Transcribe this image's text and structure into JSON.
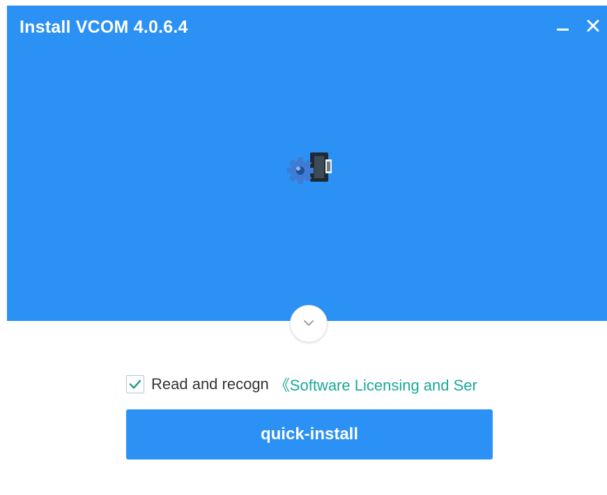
{
  "window": {
    "title": "Install VCOM 4.0.6.4"
  },
  "icons": {
    "minimize": "minimize-icon",
    "close": "close-icon",
    "app": "installer-gear-icon",
    "expand": "chevron-down-icon",
    "check": "checkmark-icon"
  },
  "agreement": {
    "checked": true,
    "text": "Read and recogn",
    "link_text": "《Software Licensing and Ser"
  },
  "install_button": {
    "label": "quick-install"
  },
  "colors": {
    "header_blue": "#2b91f5",
    "link_teal": "#1aa89a",
    "button_blue": "#2b91f5"
  }
}
